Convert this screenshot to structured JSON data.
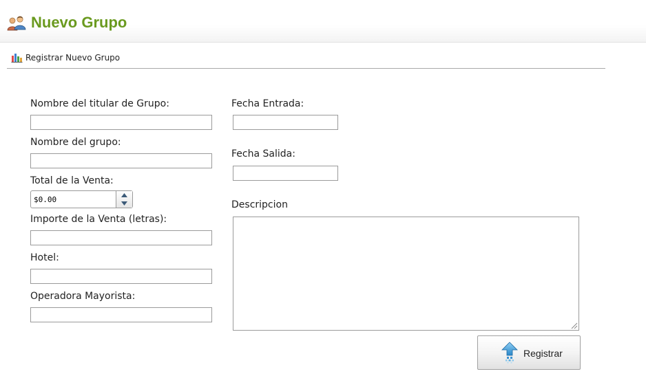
{
  "header": {
    "title": "Nuevo Grupo",
    "icon": "group-users-icon",
    "title_color": "#6a9a1f"
  },
  "toolbar": {
    "icon": "bar-chart-icon",
    "label": "Registrar Nuevo Grupo"
  },
  "form": {
    "titular_label": "Nombre del titular de Grupo:",
    "titular_value": "",
    "grupo_label": "Nombre del grupo:",
    "grupo_value": "",
    "total_label": "Total de la Venta:",
    "total_value": "$0.00",
    "importe_label": "Importe de la Venta (letras):",
    "importe_value": "",
    "hotel_label": "Hotel:",
    "hotel_value": "",
    "operadora_label": "Operadora Mayorista:",
    "operadora_value": "",
    "fecha_entrada_label": "Fecha Entrada:",
    "fecha_entrada_value": "",
    "fecha_salida_label": "Fecha Salida:",
    "fecha_salida_value": "",
    "descripcion_label": "Descripcion",
    "descripcion_value": ""
  },
  "actions": {
    "register_label": "Registrar",
    "register_icon": "upload-arrow-icon"
  }
}
